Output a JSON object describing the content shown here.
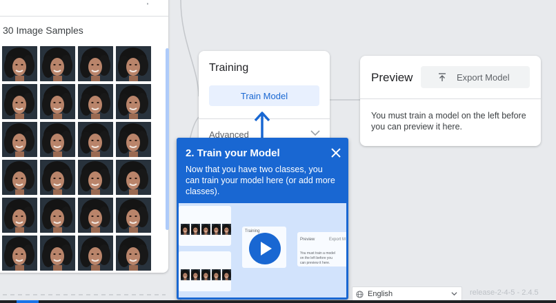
{
  "class_card": {
    "samples_title": "30 Image Samples",
    "thumbnail_count": 24
  },
  "training": {
    "title": "Training",
    "train_button": "Train Model",
    "advanced_label": "Advanced"
  },
  "preview": {
    "title": "Preview",
    "export_button": "Export Model",
    "message": "You must train a model on the left before you can preview it here."
  },
  "tooltip": {
    "title": "2. Train your Model",
    "body": "Now that you have two classes, you can train your model here (or add more classes).",
    "mini_training": "Training",
    "mini_preview": "Preview",
    "mini_export": "Export M",
    "mini_message": "You must train a model on the left before you can preview it here."
  },
  "footer": {
    "language": "English",
    "release": "release-2-4-5 - 2.4.5"
  },
  "colors": {
    "accent": "#1967d2",
    "button_bg": "#e8f0fe",
    "page_bg": "#e8eaed"
  }
}
